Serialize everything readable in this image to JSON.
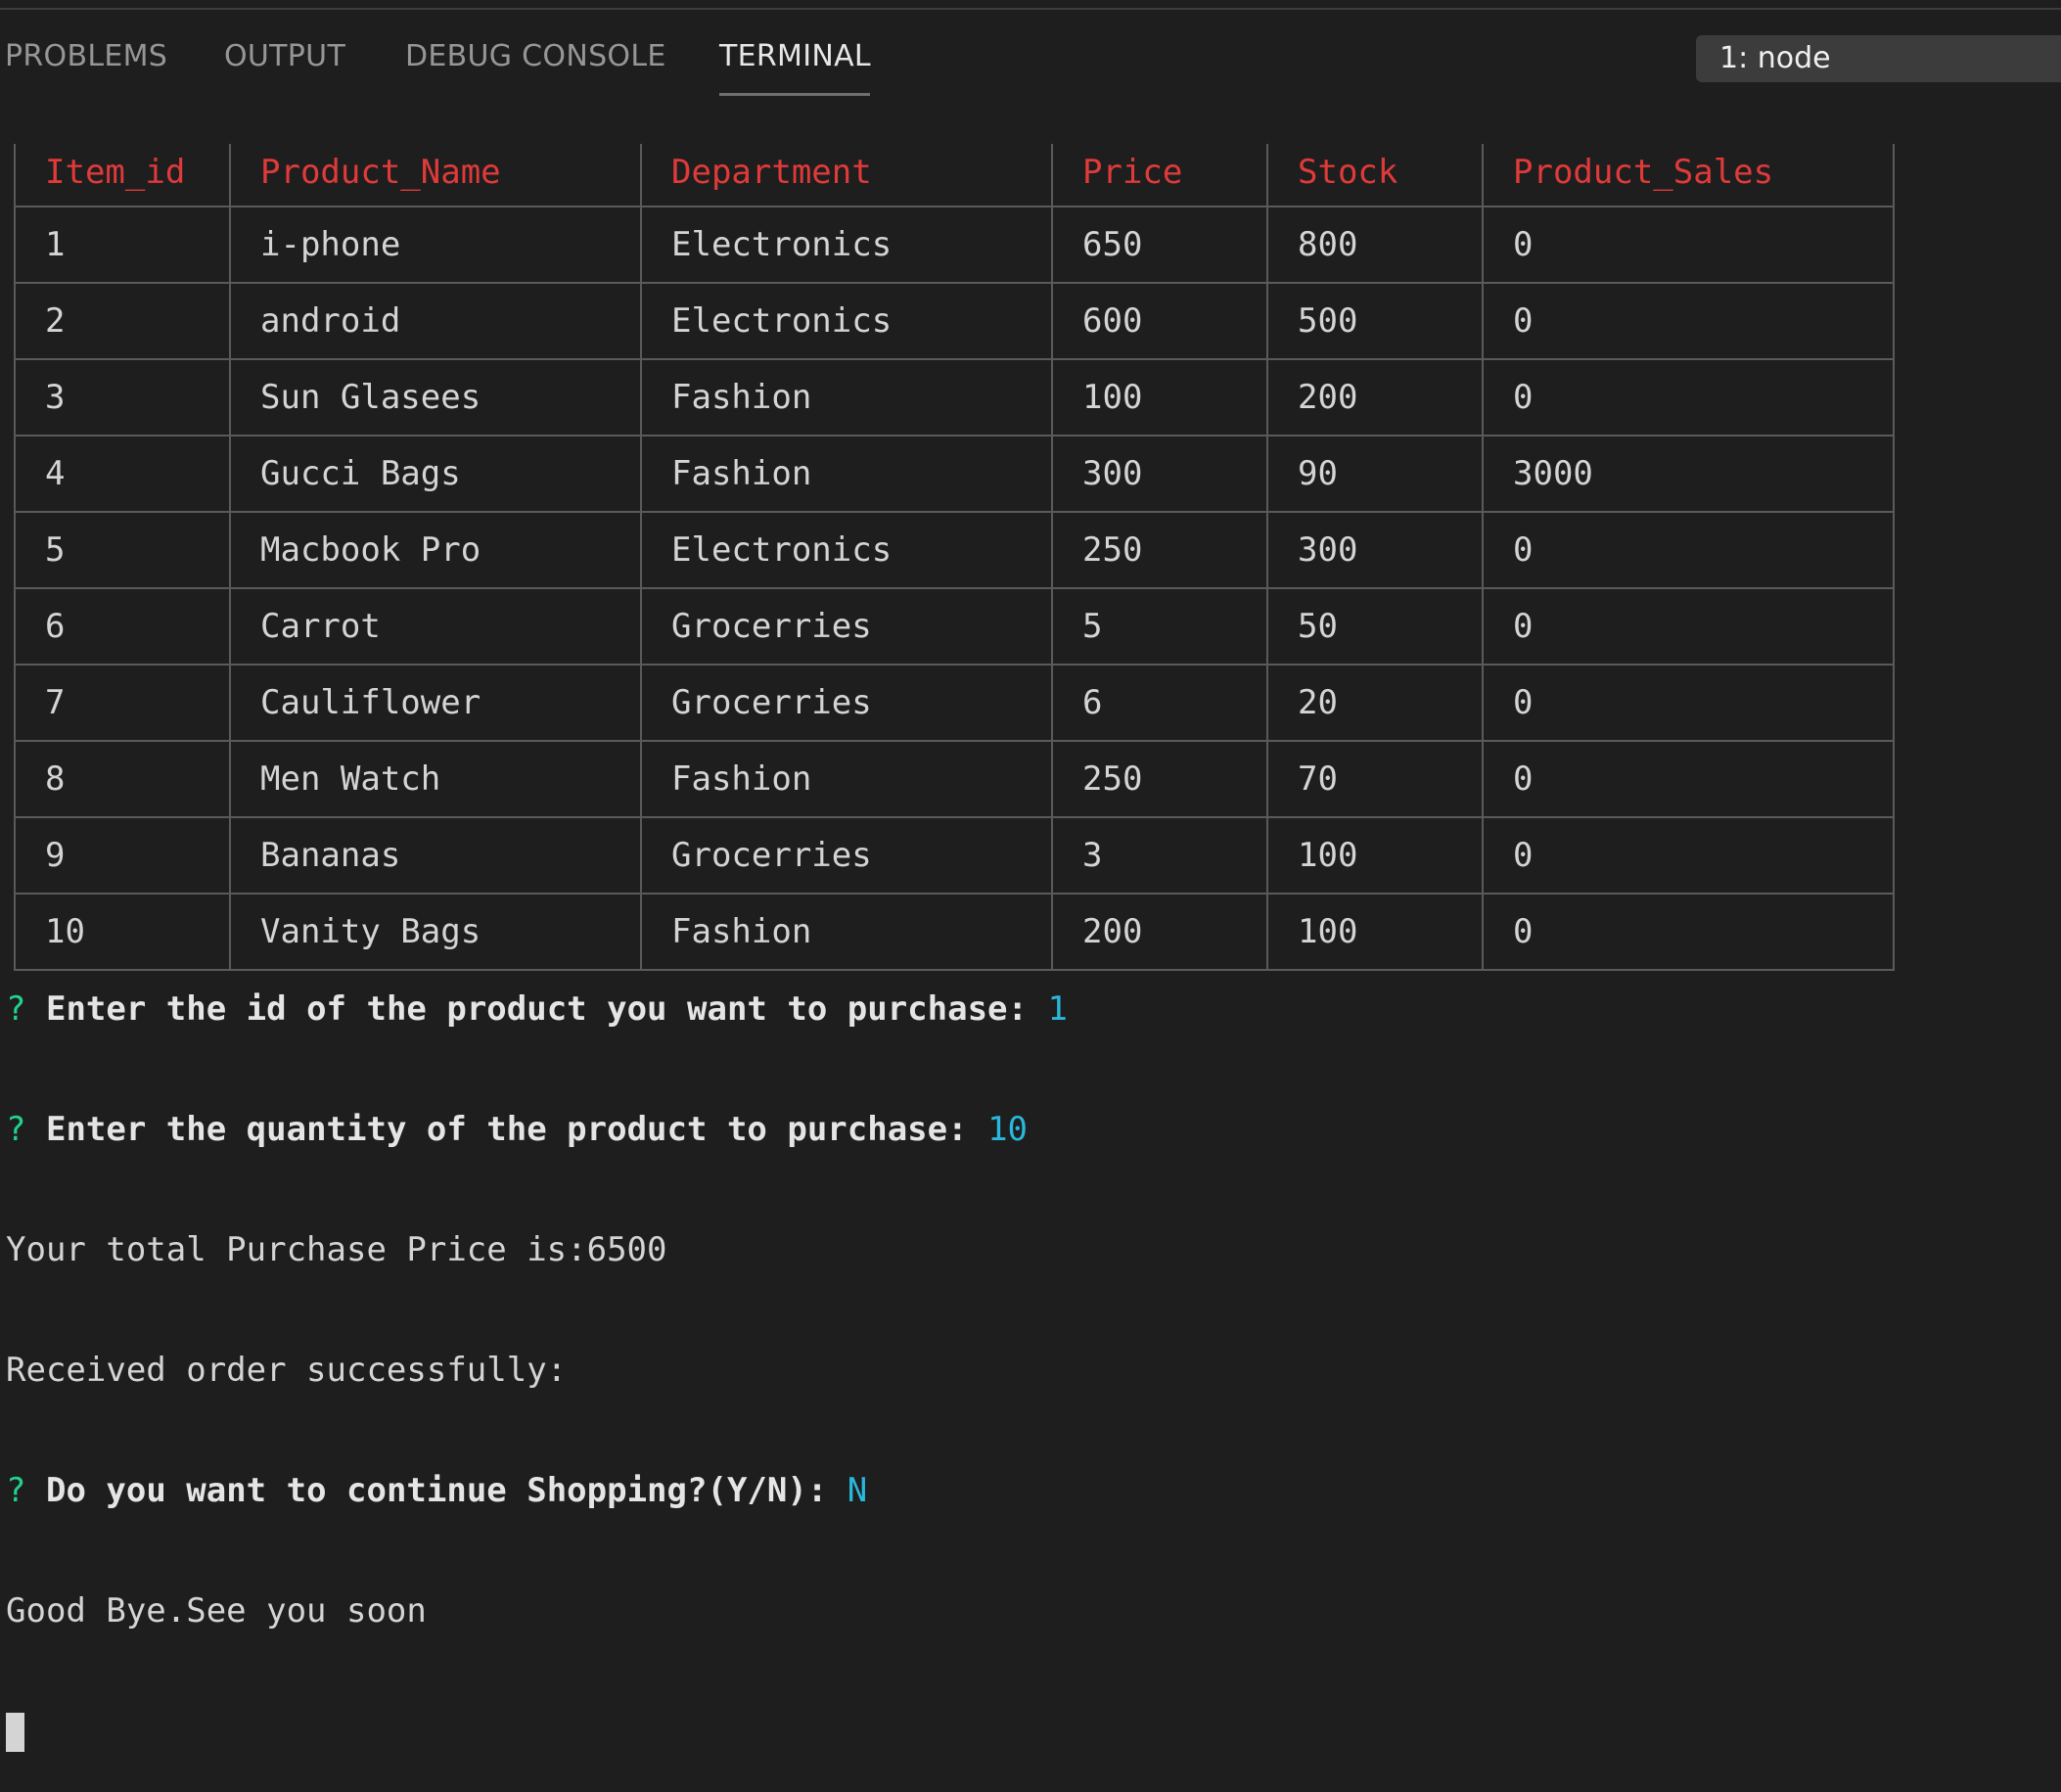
{
  "panel": {
    "tabs": [
      {
        "label": "PROBLEMS",
        "active": false
      },
      {
        "label": "OUTPUT",
        "active": false
      },
      {
        "label": "DEBUG CONSOLE",
        "active": false
      },
      {
        "label": "TERMINAL",
        "active": true
      }
    ],
    "terminal_select": "1: node"
  },
  "table": {
    "headers": [
      "Item_id",
      "Product_Name",
      "Department",
      "Price",
      "Stock",
      "Product_Sales"
    ],
    "rows": [
      [
        "1",
        "i-phone",
        "Electronics",
        "650",
        "800",
        "0"
      ],
      [
        "2",
        "android",
        "Electronics",
        "600",
        "500",
        "0"
      ],
      [
        "3",
        "Sun Glasees",
        "Fashion",
        "100",
        "200",
        "0"
      ],
      [
        "4",
        "Gucci Bags",
        "Fashion",
        "300",
        "90",
        "3000"
      ],
      [
        "5",
        "Macbook Pro",
        "Electronics",
        "250",
        "300",
        "0"
      ],
      [
        "6",
        "Carrot",
        "Grocerries",
        "5",
        "50",
        "0"
      ],
      [
        "7",
        "Cauliflower",
        "Grocerries",
        "6",
        "20",
        "0"
      ],
      [
        "8",
        "Men Watch",
        "Fashion",
        "250",
        "70",
        "0"
      ],
      [
        "9",
        "Bananas",
        "Grocerries",
        "3",
        "100",
        "0"
      ],
      [
        "10",
        "Vanity Bags",
        "Fashion",
        "200",
        "100",
        "0"
      ]
    ]
  },
  "output": {
    "prompt_mark": "?",
    "q1": {
      "text": "Enter the id of the product you want to purchase:",
      "answer": "1"
    },
    "q2": {
      "text": "Enter the quantity of the product to purchase:",
      "answer": "10"
    },
    "line3": "Your total Purchase Price is:6500",
    "line4": "Received order successfully:",
    "q3": {
      "text": "Do you want to continue Shopping?(Y/N):",
      "answer": "N"
    },
    "line6": "Good Bye.See you soon"
  },
  "colors": {
    "background": "#1e1e1e",
    "header_red": "#e03a3a",
    "prompt_green": "#23d18b",
    "answer_cyan": "#29b8db"
  }
}
